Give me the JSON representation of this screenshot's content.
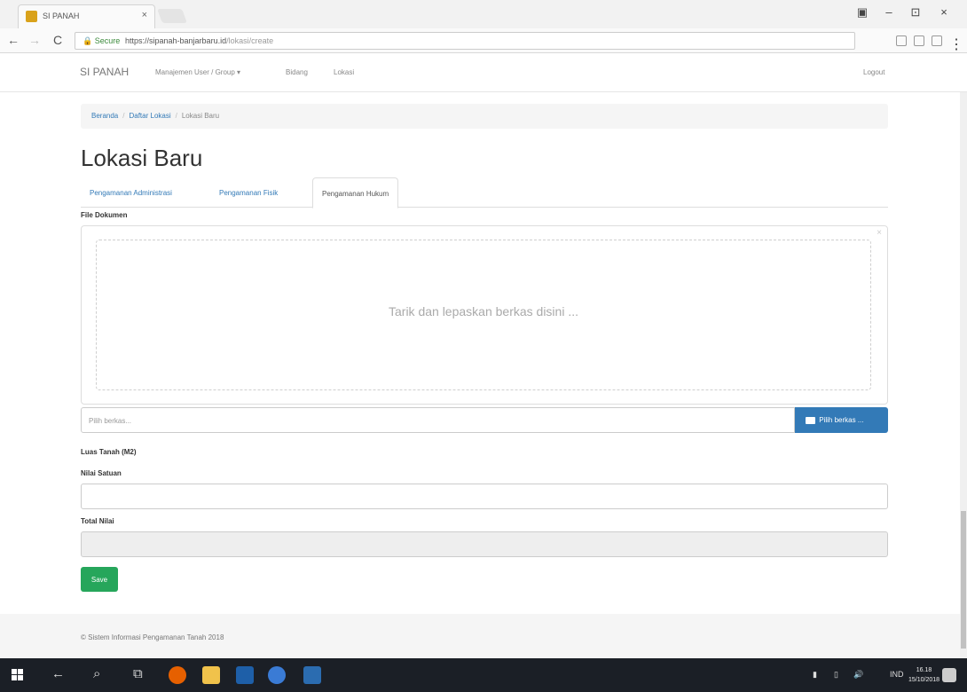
{
  "browser": {
    "tab_title": "SI PANAH",
    "tab_close": "×",
    "secure_label": "Secure",
    "url_host": "https://sipanah-banjarbaru.id",
    "url_path": "/lokasi/create",
    "back": "←",
    "forward": "→",
    "reload": "C",
    "minimize": "–",
    "maximize": "⊡",
    "close": "×"
  },
  "navbar": {
    "brand": "SI PANAH",
    "links": [
      "Manajemen User / Group ▾",
      "Bidang",
      "Lokasi"
    ],
    "logout": "Logout"
  },
  "breadcrumb": {
    "items": [
      "Beranda",
      "Daftar Lokasi"
    ],
    "active": "Lokasi Baru",
    "separator": "/"
  },
  "page_title": "Lokasi Baru",
  "tabs": [
    "Pengamanan Administrasi",
    "Pengamanan Fisik",
    "Pengamanan Hukum"
  ],
  "form": {
    "file_label": "File Dokumen",
    "drop_text": "Tarik dan lepaskan berkas disini ...",
    "file_placeholder": "Pilih berkas...",
    "browse_label": "Pilih berkas ...",
    "close_glyph": "×",
    "luas_label": "Luas Tanah (M2)",
    "nilai_label": "Nilai Satuan",
    "total_label": "Total Nilai",
    "save_label": "Save"
  },
  "footer": {
    "text": "© Sistem Informasi Pengamanan Tanah 2018"
  },
  "taskbar": {
    "time": "16.18",
    "date": "15/10/2018",
    "lang": "IND"
  },
  "colors": {
    "link": "#337ab7",
    "primary": "#337ab7",
    "success": "#26a65b",
    "taskbar": "#1b1f26"
  }
}
